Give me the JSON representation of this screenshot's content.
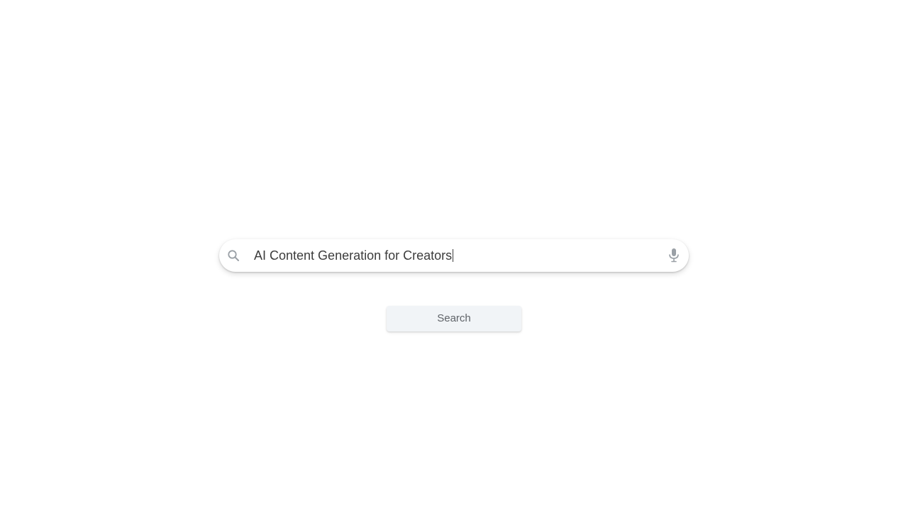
{
  "search": {
    "query": "AI Content Generation for Creators",
    "icon": "search-icon",
    "voice_icon": "microphone-icon"
  },
  "actions": {
    "search_label": "Search"
  },
  "colors": {
    "background": "#ffffff",
    "text": "#3c3c3c",
    "icon": "#9aa0a6",
    "button_bg": "#f1f4f7",
    "button_text": "#5f6368"
  }
}
